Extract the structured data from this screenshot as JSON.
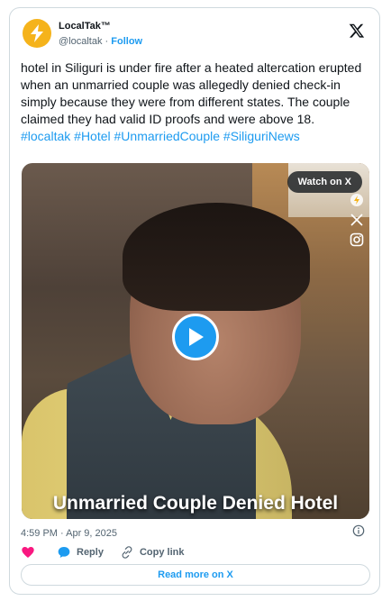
{
  "author": {
    "display_name": "LocalTak™",
    "handle": "@localtak",
    "separator": "·",
    "follow_label": "Follow"
  },
  "tweet": {
    "text": "hotel in Siliguri is under fire after a heated altercation erupted when an unmarried couple was allegedly denied check-in simply because they were from different states. The couple claimed they had valid ID proofs and were above 18.",
    "hashtags": [
      "#localtak",
      "#Hotel",
      "#UnmarriedCouple",
      "#SiliguriNews"
    ]
  },
  "media": {
    "watch_label": "Watch on X",
    "caption": "Unmarried Couple Denied Hotel",
    "side_icons": [
      "localtak-icon",
      "x-icon",
      "instagram-icon"
    ]
  },
  "meta": {
    "timestamp": "4:59 PM · Apr 9, 2025"
  },
  "actions": {
    "reply_label": "Reply",
    "copy_link_label": "Copy link"
  },
  "read_more_label": "Read more on X",
  "colors": {
    "accent": "#1d9bf0",
    "like": "#f91880",
    "logo": "#f5b31b"
  }
}
